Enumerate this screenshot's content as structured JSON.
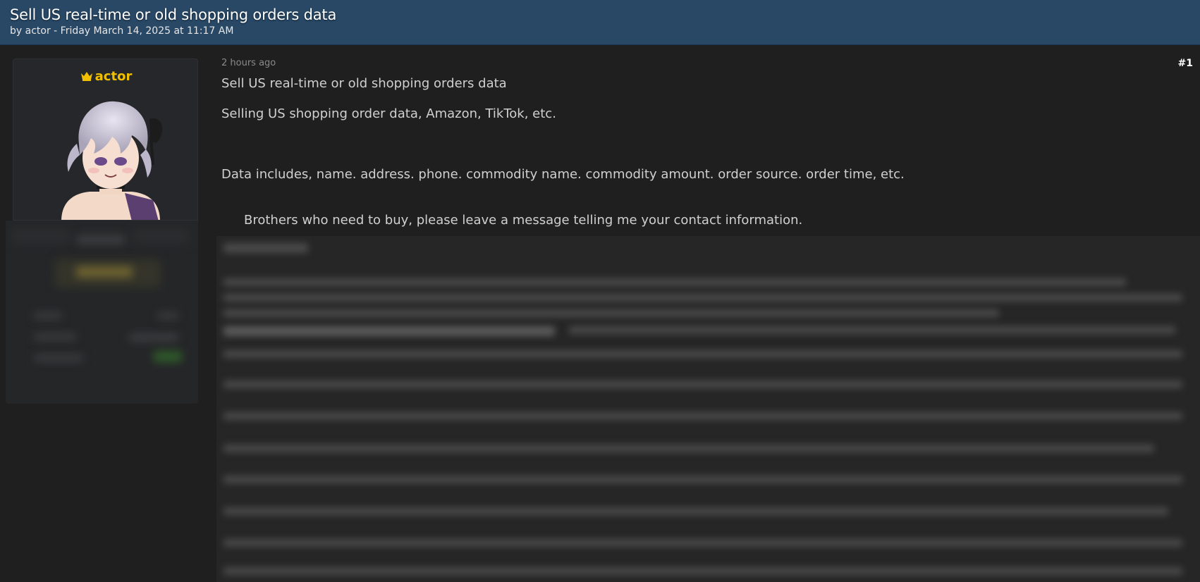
{
  "thread": {
    "title": "Sell US real-time or old shopping orders data",
    "byline": "by actor - Friday March 14, 2025 at 11:17 AM"
  },
  "author": {
    "name": "actor",
    "badge_icon": "crown-icon",
    "name_color": "#f0c000"
  },
  "post": {
    "time": "2 hours ago",
    "number": "#1",
    "lines": [
      "Sell US real-time or old shopping orders data",
      "Selling US shopping order data, Amazon, TikTok, etc.",
      "Data includes, name. address. phone. commodity name. commodity amount. order source. order time, etc.",
      "Brothers who need to buy, please leave a message telling me your contact information."
    ]
  },
  "colors": {
    "header_bg": "#284866",
    "page_bg": "#1f1f1f",
    "card_bg": "#25272a"
  }
}
